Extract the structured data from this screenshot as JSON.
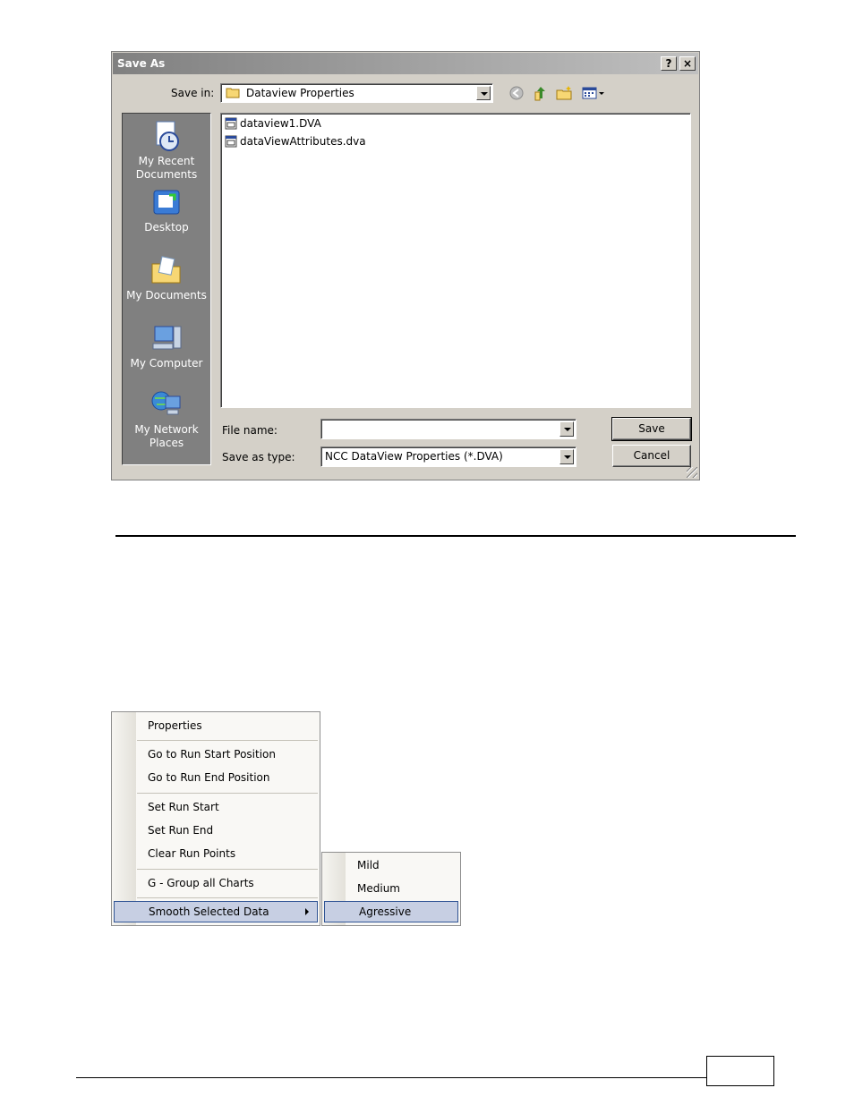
{
  "dialog": {
    "title": "Save As",
    "help_label": "?",
    "close_label": "×",
    "save_in_label": "Save in:",
    "save_in_value": "Dataview Properties",
    "places": [
      {
        "label": "My Recent Documents",
        "icon": "recent-documents-icon"
      },
      {
        "label": "Desktop",
        "icon": "desktop-icon"
      },
      {
        "label": "My Documents",
        "icon": "my-documents-icon"
      },
      {
        "label": "My Computer",
        "icon": "my-computer-icon"
      },
      {
        "label": "My Network Places",
        "icon": "network-places-icon"
      }
    ],
    "files": [
      {
        "name": "dataview1.DVA",
        "icon": "dva-file-icon"
      },
      {
        "name": "dataViewAttributes.dva",
        "icon": "dva-file-icon"
      }
    ],
    "file_name_label": "File name:",
    "file_name_value": "",
    "save_as_type_label": "Save as type:",
    "save_as_type_value": "NCC DataView Properties (*.DVA)",
    "save_button": "Save",
    "cancel_button": "Cancel"
  },
  "context_menu": {
    "items": [
      "Properties",
      "Go to Run Start Position",
      "Go to Run End Position",
      "Set Run Start",
      "Set Run End",
      "Clear Run Points",
      "G - Group all Charts",
      "Smooth Selected Data"
    ],
    "submenu": [
      "Mild",
      "Medium",
      "Agressive"
    ],
    "highlight_color": "#c7cfe3"
  }
}
